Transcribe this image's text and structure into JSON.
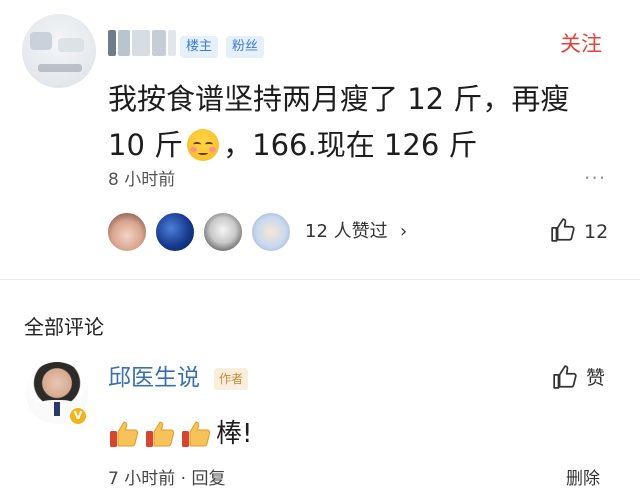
{
  "post": {
    "badges": {
      "louzhu": "楼主",
      "fensi": "粉丝"
    },
    "follow_label": "关注",
    "text_part1": "我按食谱坚持两月瘦了 12 斤，再瘦 10 斤",
    "text_part2": "，166.现在 126 斤",
    "time": "8 小时前",
    "more": "···",
    "likes_text": "12 人赞过",
    "likes_chevron": "›",
    "like_count": "12"
  },
  "comments_section": {
    "title": "全部评论"
  },
  "comment": {
    "author": "邱医生说",
    "author_tag": "作者",
    "verified_mark": "V",
    "like_label": "赞",
    "text": "棒!",
    "time": "7 小时前",
    "separator": "·",
    "reply_label": "回复",
    "delete_label": "删除"
  },
  "colors": {
    "accent_red": "#e8413c",
    "badge_blue": "#3b7bd6",
    "name_blue": "#3a6fb0",
    "author_tag": "#c68a3c"
  }
}
